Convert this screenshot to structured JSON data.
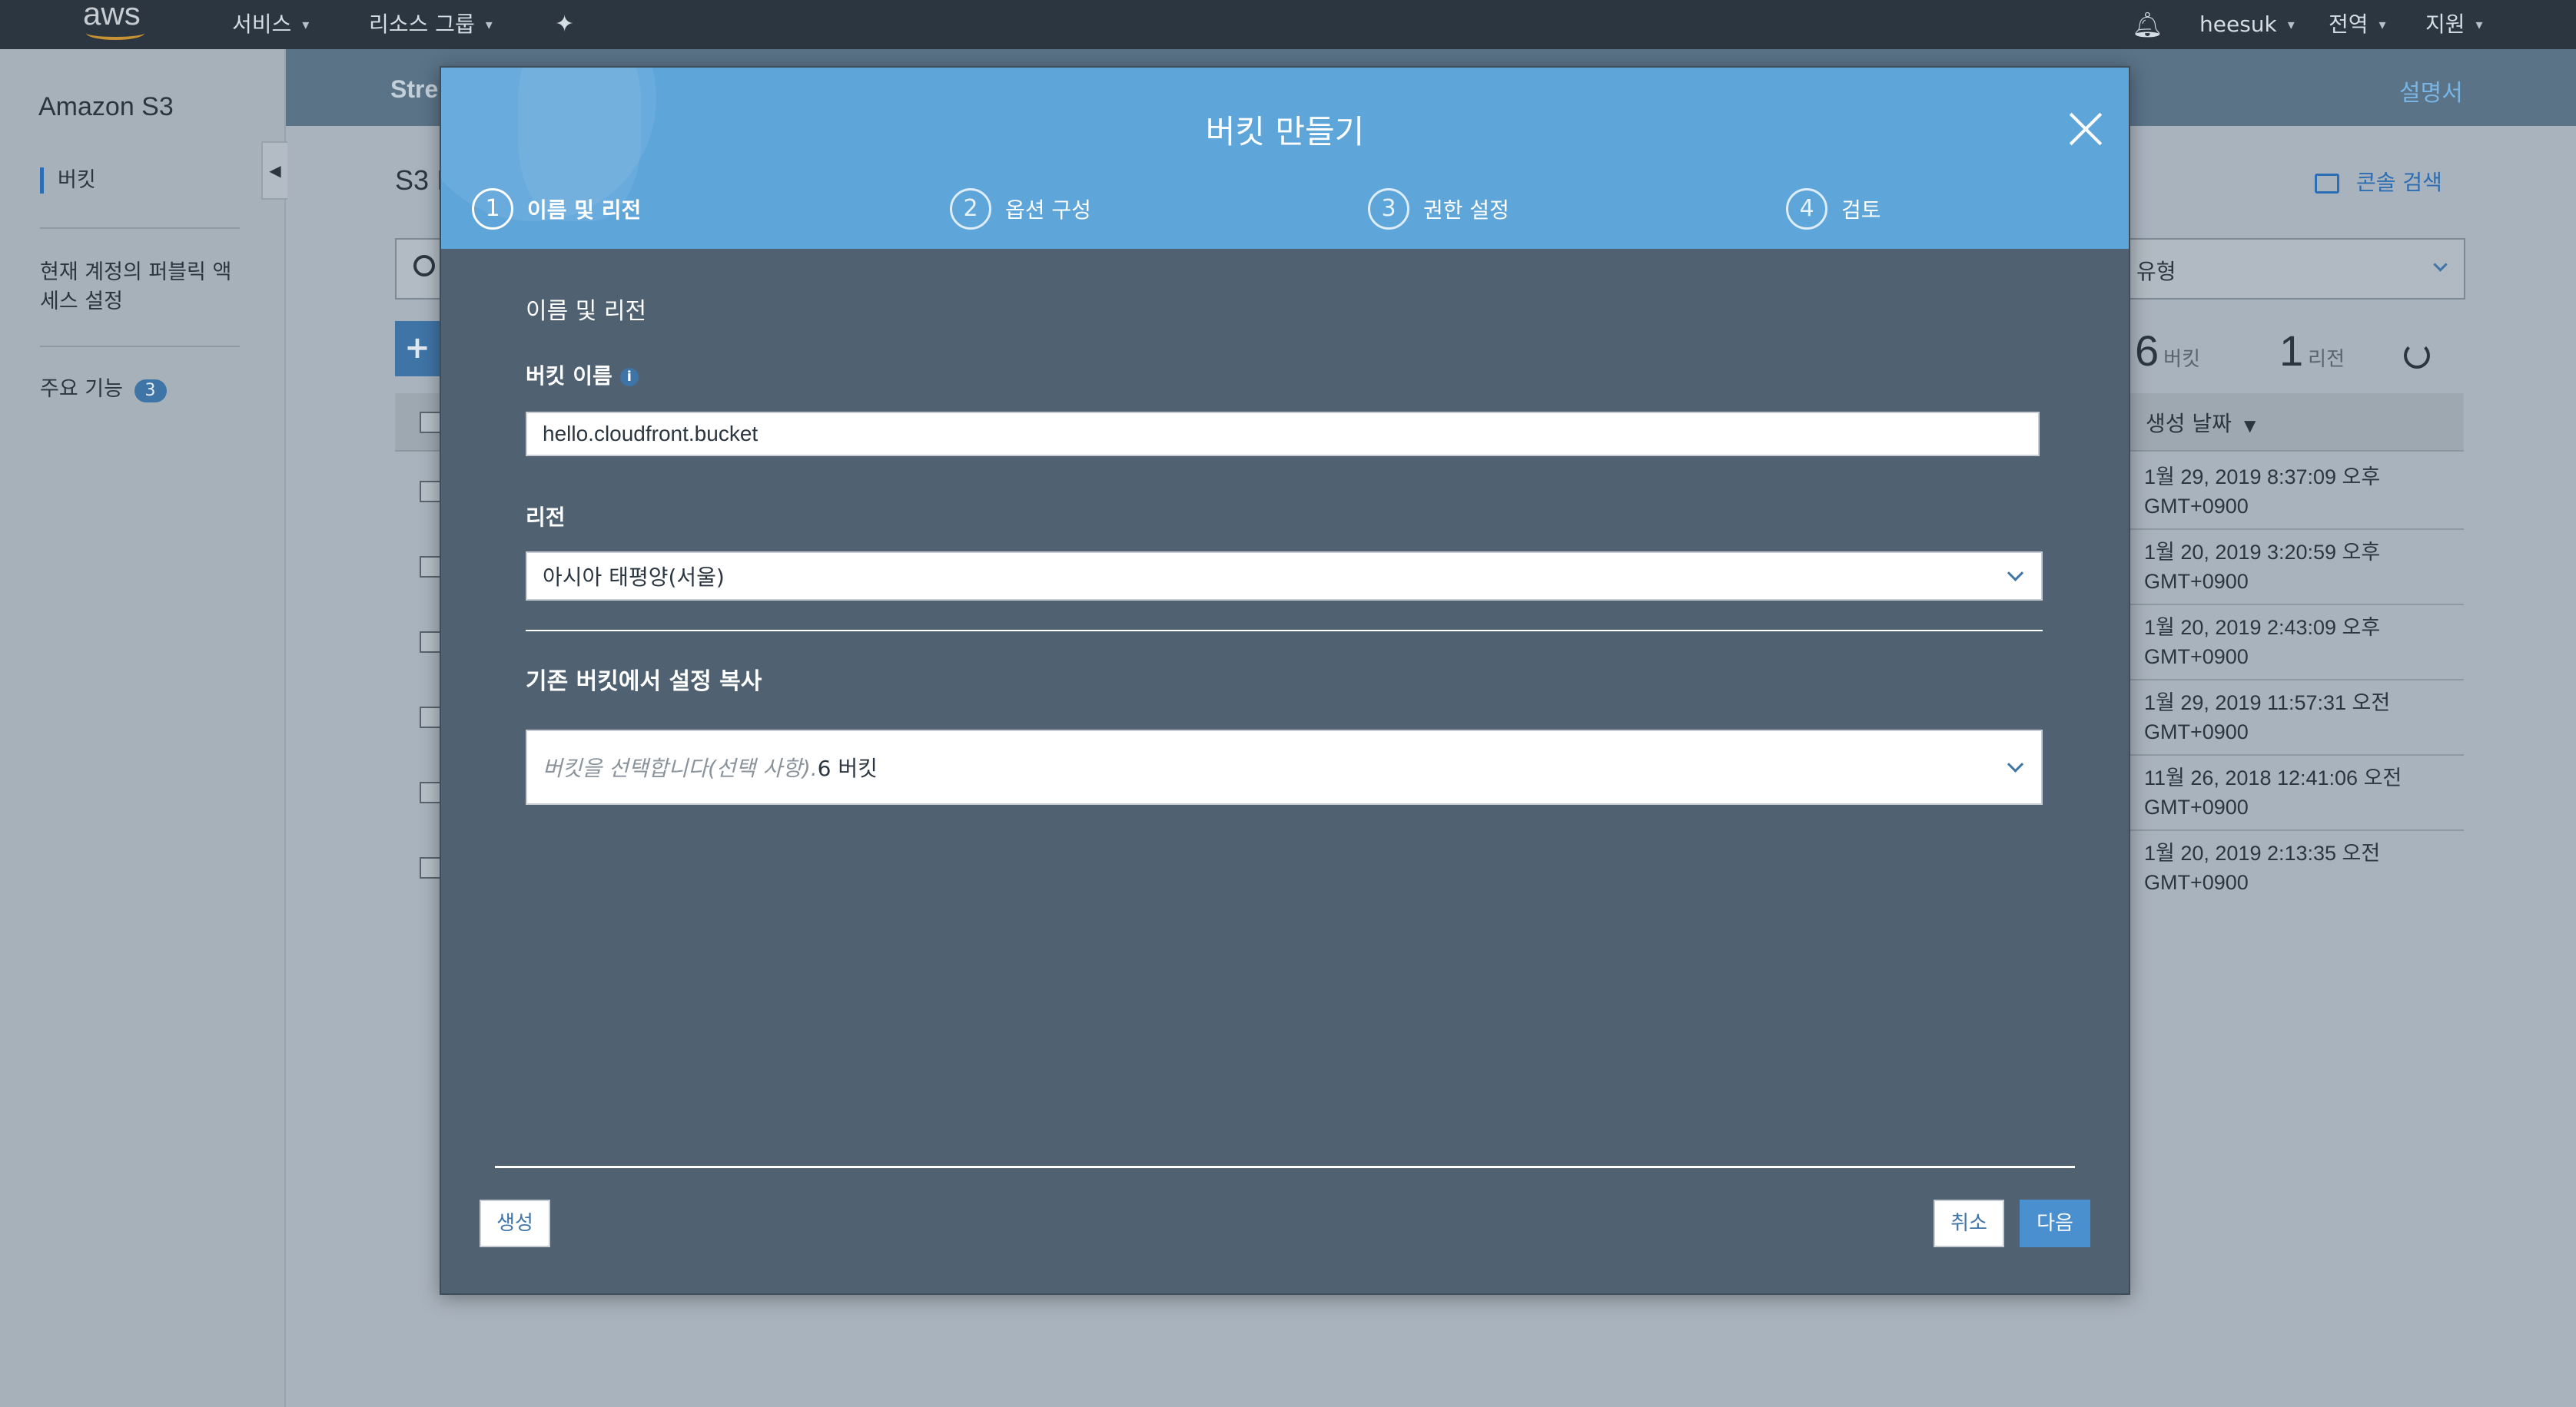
{
  "topnav": {
    "logo": "aws",
    "services": "서비스",
    "resource_groups": "리소스 그룹",
    "user": "heesuk",
    "region": "전역",
    "support": "지원"
  },
  "sidebar": {
    "title": "Amazon S3",
    "items": [
      {
        "label": "버킷"
      },
      {
        "label": "현재 계정의 퍼블릭 액세스 설정"
      },
      {
        "label": "주요 기능",
        "badge": "3"
      }
    ]
  },
  "background": {
    "banner_left": "Stre",
    "banner_right": "설명서",
    "page_title": "S3 I",
    "console_search": "콘솔 검색",
    "type_filter": "유형",
    "bucket_count": "6",
    "bucket_label": "버킷",
    "region_count": "1",
    "region_label": "리전",
    "table": {
      "date_header": "생성 날짜",
      "dates": [
        {
          "date": "1월 29, 2019 8:37:09 오후",
          "tz": "GMT+0900"
        },
        {
          "date": "1월 20, 2019 3:20:59 오후",
          "tz": "GMT+0900"
        },
        {
          "date": "1월 20, 2019 2:43:09 오후",
          "tz": "GMT+0900"
        },
        {
          "date": "1월 29, 2019 11:57:31 오전",
          "tz": "GMT+0900"
        },
        {
          "date": "11월 26, 2018 12:41:06 오전",
          "tz": "GMT+0900"
        },
        {
          "date": "1월 20, 2019 2:13:35 오전",
          "tz": "GMT+0900"
        }
      ]
    }
  },
  "modal": {
    "title": "버킷 만들기",
    "steps": [
      {
        "num": "1",
        "label": "이름 및 리전"
      },
      {
        "num": "2",
        "label": "옵션 구성"
      },
      {
        "num": "3",
        "label": "권한 설정"
      },
      {
        "num": "4",
        "label": "검토"
      }
    ],
    "section_title": "이름 및 리전",
    "bucket_name_label": "버킷 이름",
    "bucket_name_value": "hello.cloudfront.bucket",
    "region_label": "리전",
    "region_value": "아시아 태평양(서울)",
    "copy_section_title": "기존 버킷에서 설정 복사",
    "copy_placeholder": "버킷을 선택합니다(선택 사항).",
    "copy_count": "6 버킷",
    "buttons": {
      "create": "생성",
      "cancel": "취소",
      "next": "다음"
    }
  },
  "colors": {
    "header_blue": "#5ea5da",
    "modal_body": "#506272",
    "accent": "#3f74a7",
    "primary_button": "#4a8fce",
    "nav_bg": "#2b3640"
  }
}
